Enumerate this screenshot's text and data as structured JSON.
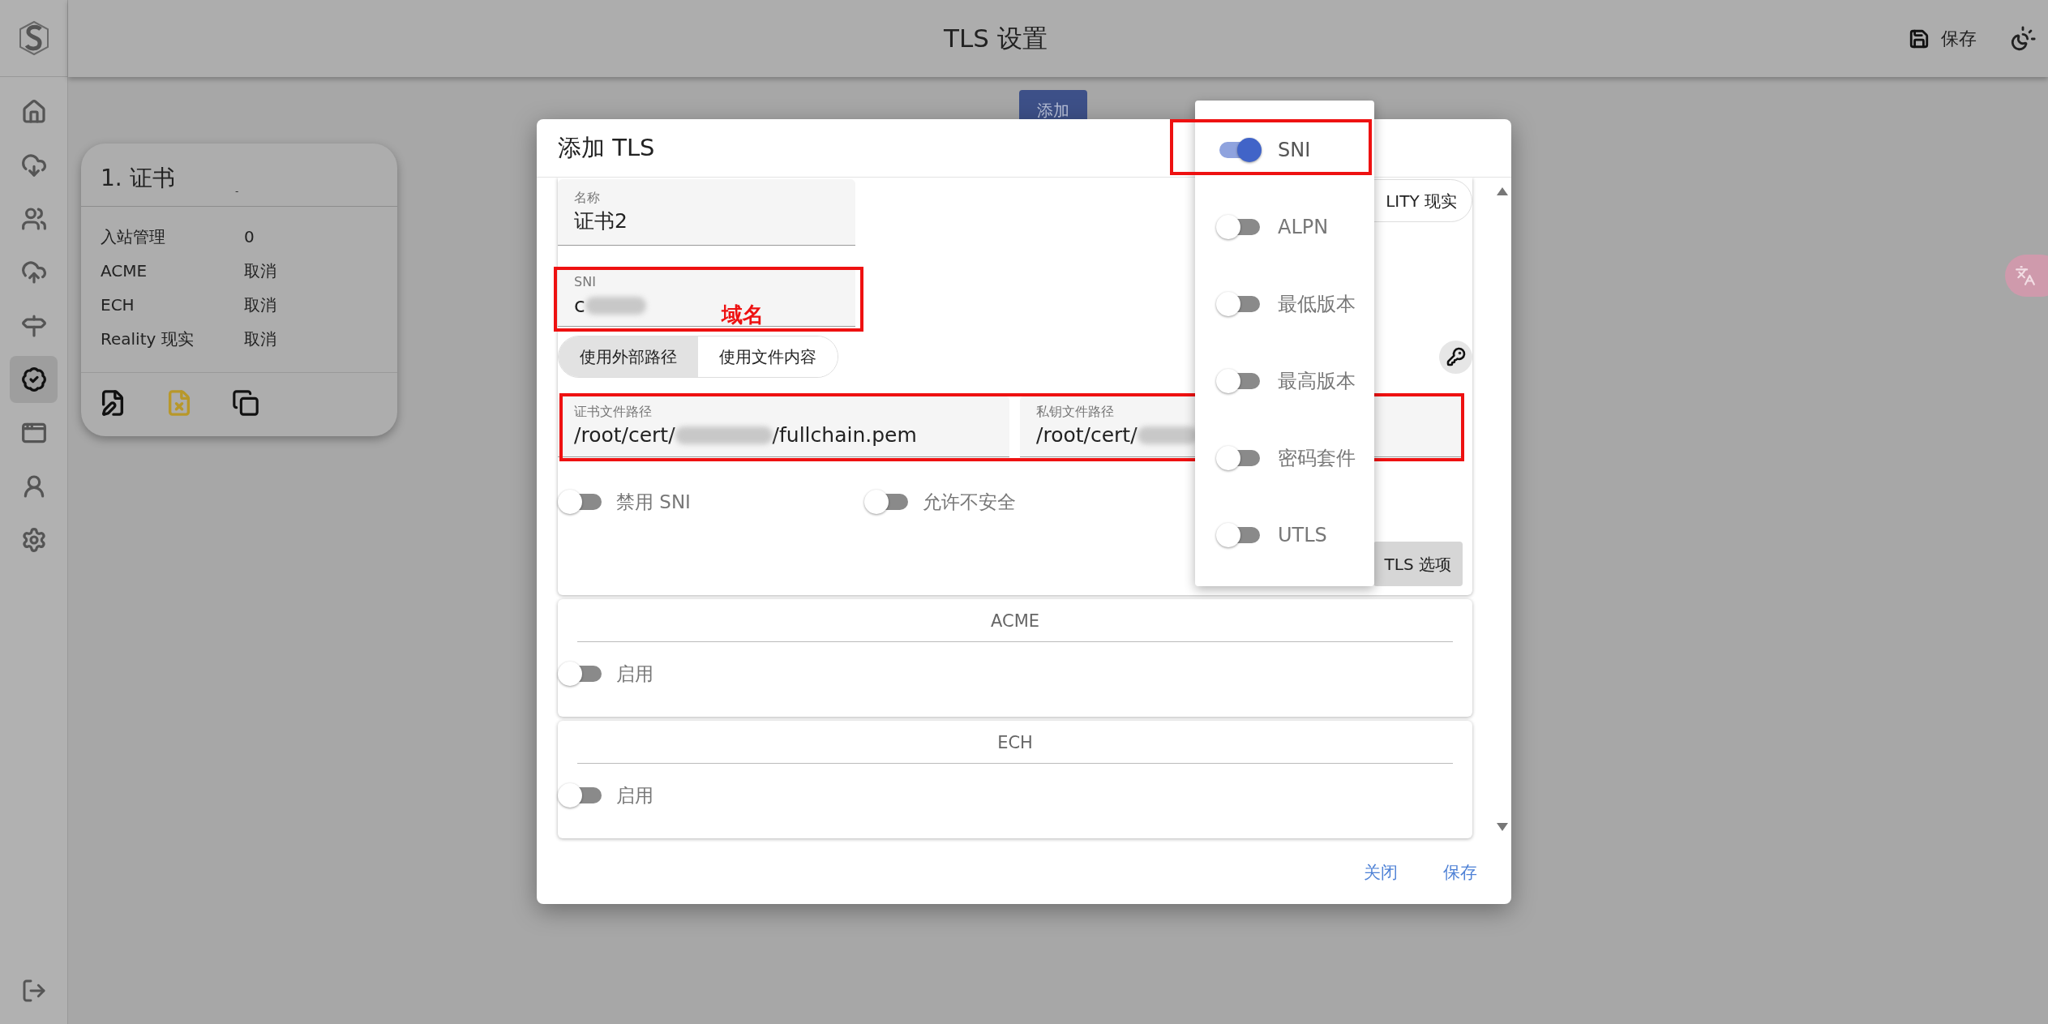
{
  "sidebar": {
    "items": [
      {
        "selected": false
      },
      {
        "selected": false
      },
      {
        "selected": false
      },
      {
        "selected": false
      },
      {
        "selected": false
      },
      {
        "selected": true
      },
      {
        "selected": false
      },
      {
        "selected": false
      },
      {
        "selected": false
      }
    ]
  },
  "header": {
    "title": "TLS 设置",
    "save_button": "保存"
  },
  "add_button": "添加",
  "card": {
    "title": "1. 证书",
    "subtitle": "-",
    "rows": [
      {
        "label": "入站管理",
        "value": "0"
      },
      {
        "label": "ACME",
        "value": "取消"
      },
      {
        "label": "ECH",
        "value": "取消"
      },
      {
        "label": "Reality 现实",
        "value": "取消"
      }
    ]
  },
  "dialog": {
    "title": "添加 TLS",
    "name_field": {
      "label": "名称",
      "value": "证书2"
    },
    "sni_field": {
      "label": "SNI",
      "value": "c",
      "redacted": true
    },
    "path_modes": [
      {
        "label": "使用外部路径",
        "selected": true
      },
      {
        "label": "使用文件内容",
        "selected": false
      }
    ],
    "cert_path_field": {
      "label": "证书文件路径",
      "value": "/root/cert/",
      "redacted": true,
      "value_end": "/fullchain.pem"
    },
    "key_path_field": {
      "label": "私钥文件路径",
      "value": "/root/cert/",
      "redacted": true
    },
    "switches": [
      {
        "label": "禁用 SNI",
        "on": false
      },
      {
        "label": "允许不安全",
        "on": false
      }
    ],
    "reality_button": "LITY 现实",
    "tls_options_button": "TLS 选项",
    "sections": [
      {
        "title": "ACME",
        "switch": {
          "label": "启用",
          "on": false
        }
      },
      {
        "title": "ECH",
        "switch": {
          "label": "启用",
          "on": false
        }
      }
    ],
    "buttons": [
      "关闭",
      "保存"
    ]
  },
  "menu": {
    "items": [
      {
        "label": "SNI",
        "on": true
      },
      {
        "label": "ALPN",
        "on": false
      },
      {
        "label": "最低版本",
        "on": false
      },
      {
        "label": "最高版本",
        "on": false
      },
      {
        "label": "密码套件",
        "on": false
      },
      {
        "label": "UTLS",
        "on": false
      }
    ]
  },
  "annotation": {
    "label": "域名"
  }
}
